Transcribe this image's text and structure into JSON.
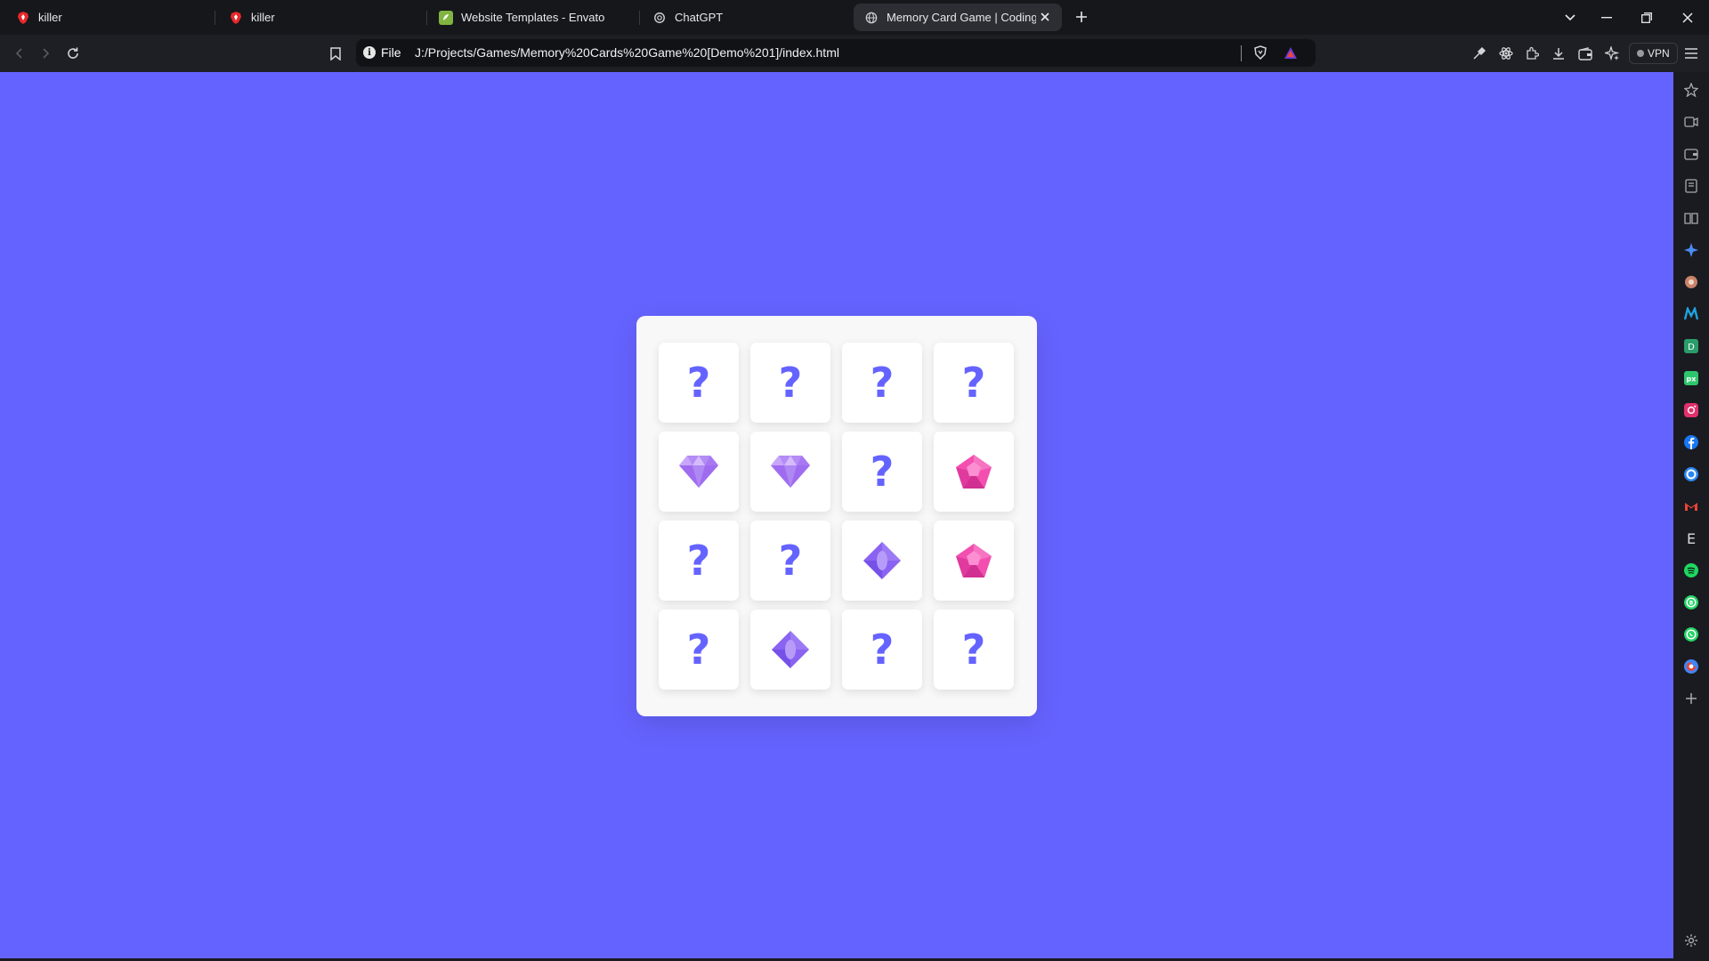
{
  "browser": {
    "tabs": [
      {
        "title": "killer",
        "icon": "brave-logo-icon"
      },
      {
        "title": "killer",
        "icon": "brave-logo-icon"
      },
      {
        "title": "Website Templates - Envato",
        "icon": "envato-icon"
      },
      {
        "title": "ChatGPT",
        "icon": "chatgpt-icon"
      },
      {
        "title": "Memory Card Game | Coding U",
        "icon": "globe-icon",
        "active": true
      }
    ],
    "address": {
      "scheme_label": "File",
      "url": "J:/Projects/Games/Memory%20Cards%20Game%20[Demo%201]/index.html"
    },
    "vpn_label": "VPN"
  },
  "game": {
    "rows": 4,
    "cols": 4,
    "hidden_symbol": "?",
    "cards": [
      {
        "state": "hidden"
      },
      {
        "state": "hidden"
      },
      {
        "state": "hidden"
      },
      {
        "state": "hidden"
      },
      {
        "state": "flipped",
        "image": "purple-gem-icon"
      },
      {
        "state": "flipped",
        "image": "purple-gem-icon"
      },
      {
        "state": "hidden"
      },
      {
        "state": "flipped",
        "image": "pink-gem-icon"
      },
      {
        "state": "hidden"
      },
      {
        "state": "hidden"
      },
      {
        "state": "flipped",
        "image": "violet-diamond-icon"
      },
      {
        "state": "flipped",
        "image": "pink-gem-icon"
      },
      {
        "state": "hidden"
      },
      {
        "state": "flipped",
        "image": "violet-diamond-icon"
      },
      {
        "state": "hidden"
      },
      {
        "state": "hidden"
      }
    ]
  },
  "sidebar": {
    "items": [
      {
        "icon": "bookmark-star-icon"
      },
      {
        "icon": "video-icon"
      },
      {
        "icon": "wallet-icon"
      },
      {
        "icon": "reading-list-icon"
      },
      {
        "icon": "book-icon"
      },
      {
        "icon": "leo-ai-icon"
      },
      {
        "icon": "web3-icon"
      },
      {
        "icon": "m-app-icon"
      },
      {
        "icon": "d-app-icon"
      },
      {
        "icon": "pixabay-icon"
      },
      {
        "icon": "instagram-icon"
      },
      {
        "icon": "facebook-icon"
      },
      {
        "icon": "c-app-icon"
      },
      {
        "icon": "gmail-icon"
      },
      {
        "icon": "envato-e-icon"
      },
      {
        "icon": "spotify-icon"
      },
      {
        "icon": "whatsapp-business-icon"
      },
      {
        "icon": "whatsapp-icon"
      },
      {
        "icon": "google-chat-icon"
      },
      {
        "icon": "add-icon"
      }
    ]
  },
  "colors": {
    "page_background": "#6563ff",
    "card_accent": "#6563ff"
  }
}
